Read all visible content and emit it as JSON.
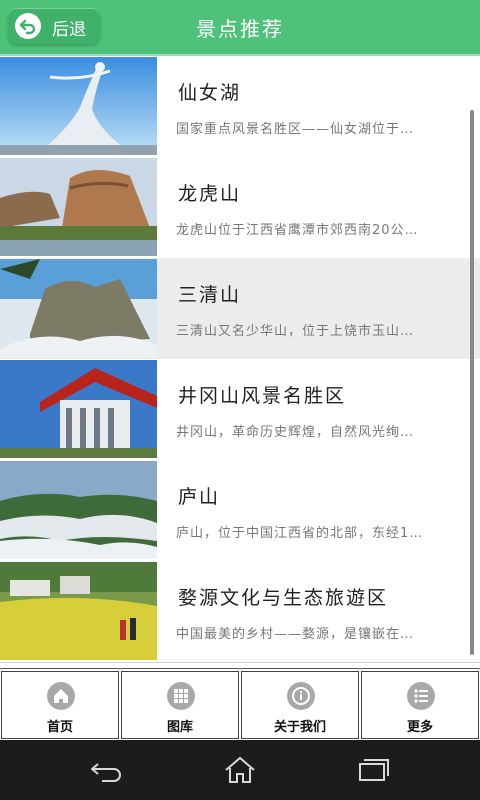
{
  "header": {
    "back_label": "后退",
    "title": "景点推荐"
  },
  "spots": [
    {
      "title": "仙女湖",
      "desc": "国家重点风景名胜区——仙女湖位于…"
    },
    {
      "title": "龙虎山",
      "desc": "龙虎山位于江西省鹰潭市郊西南20公…"
    },
    {
      "title": "三清山",
      "desc": "三清山又名少华山，位于上饶市玉山…"
    },
    {
      "title": "井冈山风景名胜区",
      "desc": "井冈山，革命历史辉煌，自然风光绚…"
    },
    {
      "title": "庐山",
      "desc": "庐山，位于中国江西省的北部，东经1…"
    },
    {
      "title": "婺源文化与生态旅遊区",
      "desc": "中国最美的乡村——婺源，是镶嵌在…"
    }
  ],
  "nav": {
    "home": "首页",
    "gallery": "图库",
    "about": "关于我们",
    "more": "更多"
  },
  "colors": {
    "header": "#4ec27a",
    "selected_row": "#ececec",
    "system_bar": "#1c1c1c"
  }
}
